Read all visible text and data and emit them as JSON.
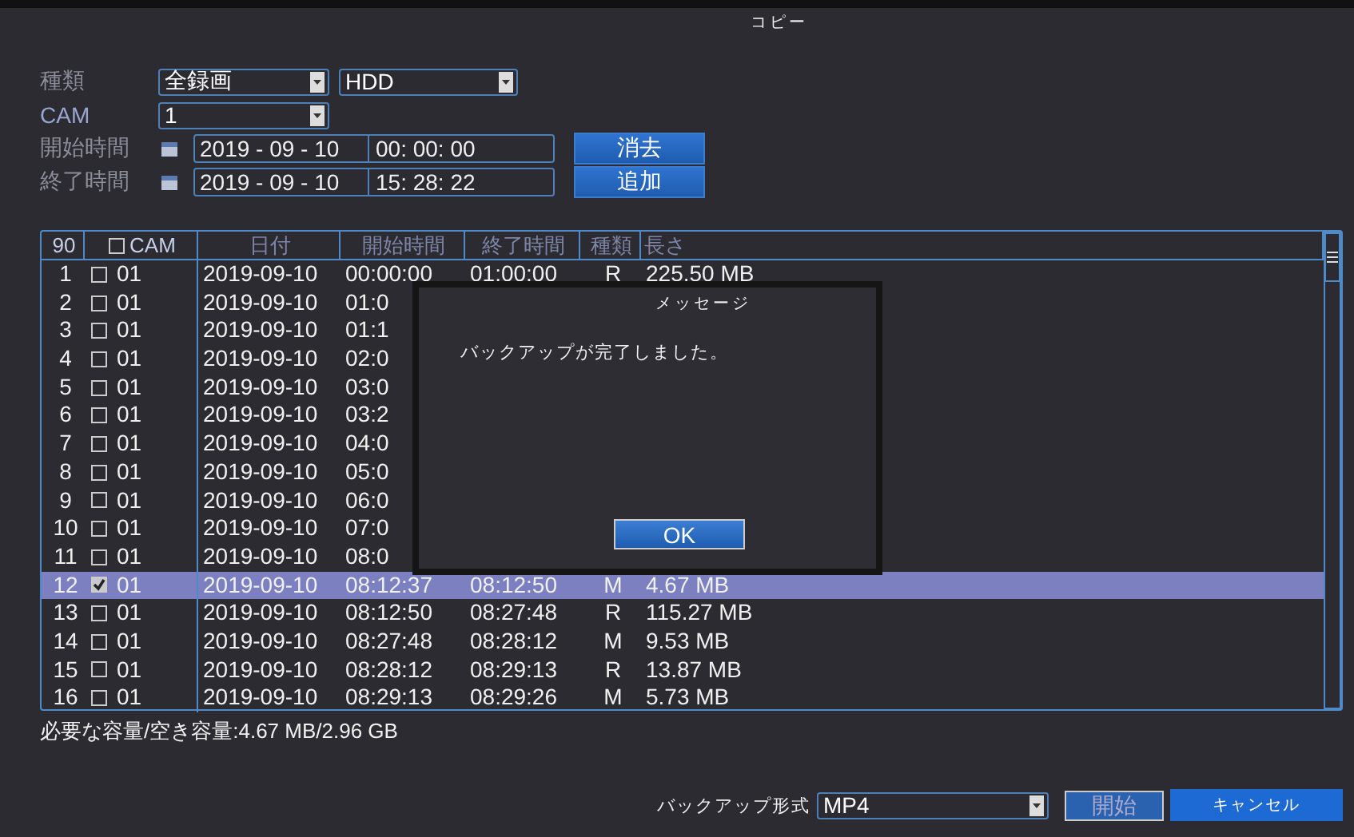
{
  "window": {
    "title": "コピー"
  },
  "form": {
    "type_label": "種類",
    "type_value": "全録画",
    "device_value": "HDD",
    "cam_label": "CAM",
    "cam_value": "1",
    "start_label": "開始時間",
    "start_date": "2019 - 09 - 10",
    "start_time": "00: 00: 00",
    "clear_button": "消去",
    "end_label": "終了時間",
    "end_date": "2019 - 09 - 10",
    "end_time": "15: 28: 22",
    "add_button": "追加"
  },
  "table": {
    "columns": [
      "90",
      "CAM",
      "日付",
      "開始時間",
      "終了時間",
      "種類",
      "長さ"
    ],
    "all_checked": false,
    "rows": [
      {
        "no": "1",
        "checked": false,
        "cam": "01",
        "date": "2019-09-10",
        "start": "00:00:00",
        "end": "01:00:00",
        "type": "R",
        "size": "225.50 MB",
        "selected": false
      },
      {
        "no": "2",
        "checked": false,
        "cam": "01",
        "date": "2019-09-10",
        "start": "01:0",
        "selected": false
      },
      {
        "no": "3",
        "checked": false,
        "cam": "01",
        "date": "2019-09-10",
        "start": "01:1",
        "selected": false
      },
      {
        "no": "4",
        "checked": false,
        "cam": "01",
        "date": "2019-09-10",
        "start": "02:0",
        "selected": false
      },
      {
        "no": "5",
        "checked": false,
        "cam": "01",
        "date": "2019-09-10",
        "start": "03:0",
        "selected": false
      },
      {
        "no": "6",
        "checked": false,
        "cam": "01",
        "date": "2019-09-10",
        "start": "03:2",
        "selected": false
      },
      {
        "no": "7",
        "checked": false,
        "cam": "01",
        "date": "2019-09-10",
        "start": "04:0",
        "selected": false
      },
      {
        "no": "8",
        "checked": false,
        "cam": "01",
        "date": "2019-09-10",
        "start": "05:0",
        "selected": false
      },
      {
        "no": "9",
        "checked": false,
        "cam": "01",
        "date": "2019-09-10",
        "start": "06:0",
        "selected": false
      },
      {
        "no": "10",
        "checked": false,
        "cam": "01",
        "date": "2019-09-10",
        "start": "07:0",
        "selected": false
      },
      {
        "no": "11",
        "checked": false,
        "cam": "01",
        "date": "2019-09-10",
        "start": "08:0",
        "selected": false
      },
      {
        "no": "12",
        "checked": true,
        "cam": "01",
        "date": "2019-09-10",
        "start": "08:12:37",
        "end": "08:12:50",
        "type": "M",
        "size": "4.67 MB",
        "selected": true
      },
      {
        "no": "13",
        "checked": false,
        "cam": "01",
        "date": "2019-09-10",
        "start": "08:12:50",
        "end": "08:27:48",
        "type": "R",
        "size": "115.27 MB",
        "selected": false
      },
      {
        "no": "14",
        "checked": false,
        "cam": "01",
        "date": "2019-09-10",
        "start": "08:27:48",
        "end": "08:28:12",
        "type": "M",
        "size": "9.53 MB",
        "selected": false
      },
      {
        "no": "15",
        "checked": false,
        "cam": "01",
        "date": "2019-09-10",
        "start": "08:28:12",
        "end": "08:29:13",
        "type": "R",
        "size": "13.87 MB",
        "selected": false
      },
      {
        "no": "16",
        "checked": false,
        "cam": "01",
        "date": "2019-09-10",
        "start": "08:29:13",
        "end": "08:29:26",
        "type": "M",
        "size": "5.73 MB",
        "selected": false
      }
    ]
  },
  "capacity": "必要な容量/空き容量:4.67 MB/2.96 GB",
  "footer": {
    "format_label": "バックアップ形式",
    "format_value": "MP4",
    "start_button": "開始",
    "cancel_button": "キャンセル"
  },
  "dialog": {
    "title": "メッセージ",
    "message": "バックアップが完了しました。",
    "ok_button": "OK"
  }
}
